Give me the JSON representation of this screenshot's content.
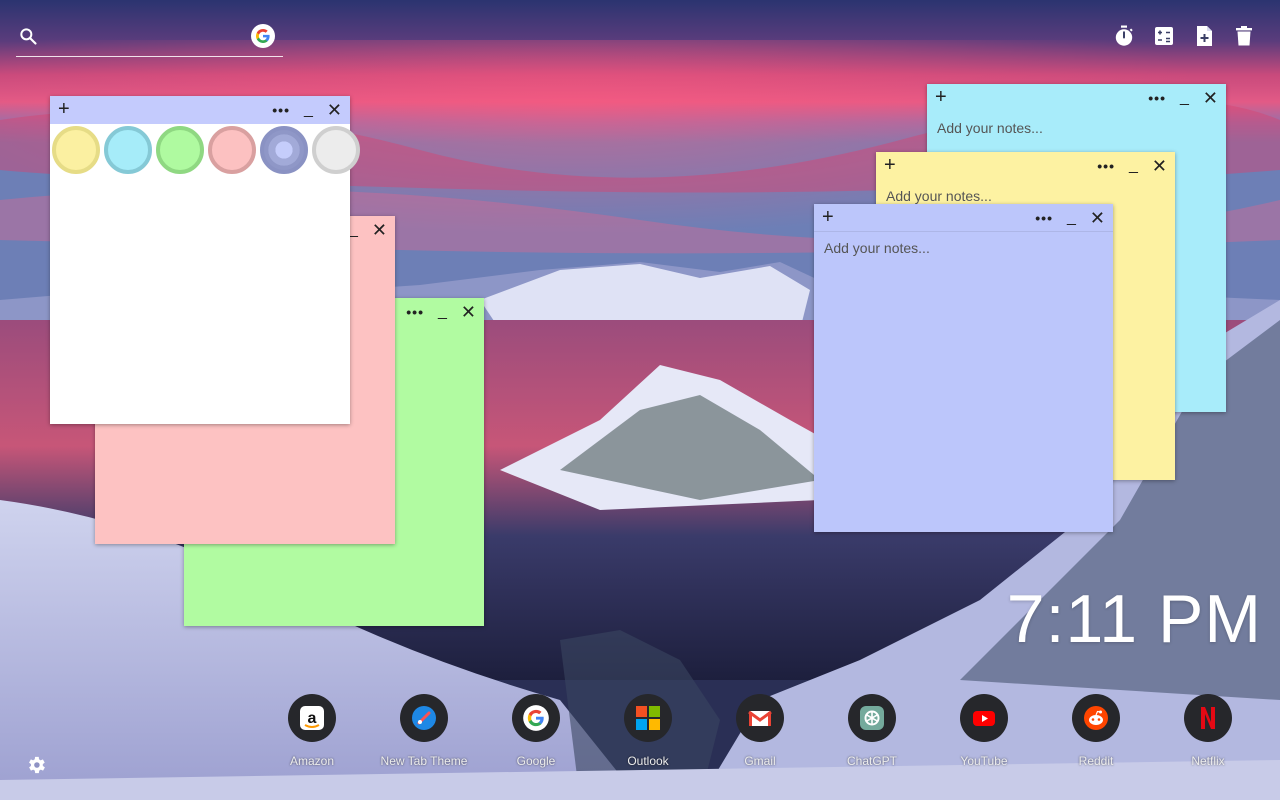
{
  "search": {
    "placeholder": "",
    "search_icon": "search-icon",
    "engine_icon": "google-g-icon"
  },
  "toolbar": [
    {
      "icon": "timer-icon"
    },
    {
      "icon": "calculator-icon"
    },
    {
      "icon": "add-note-icon"
    },
    {
      "icon": "trash-icon"
    }
  ],
  "notes": {
    "plus": "+",
    "more": "•••",
    "minimize": "_",
    "close": "✕",
    "placeholder": "Add your notes..."
  },
  "colors": {
    "note_yellow": "#fdf2a2",
    "note_cyan": "#a8ecfa",
    "note_green": "#b1fba1",
    "note_pink": "#fdc2c2",
    "note_lavender": "#bcc6fb",
    "note_white": "#ffffff"
  },
  "clock": {
    "time": "7:11 PM"
  },
  "shortcuts": [
    {
      "label": "Amazon",
      "icon": "amazon-icon"
    },
    {
      "label": "New Tab Theme",
      "icon": "new-tab-theme-icon"
    },
    {
      "label": "Google",
      "icon": "google-icon"
    },
    {
      "label": "Outlook",
      "icon": "outlook-icon"
    },
    {
      "label": "Gmail",
      "icon": "gmail-icon"
    },
    {
      "label": "ChatGPT",
      "icon": "chatgpt-icon"
    },
    {
      "label": "YouTube",
      "icon": "youtube-icon"
    },
    {
      "label": "Reddit",
      "icon": "reddit-icon"
    },
    {
      "label": "Netflix",
      "icon": "netflix-icon"
    }
  ],
  "settings": {
    "icon": "gear-icon"
  }
}
